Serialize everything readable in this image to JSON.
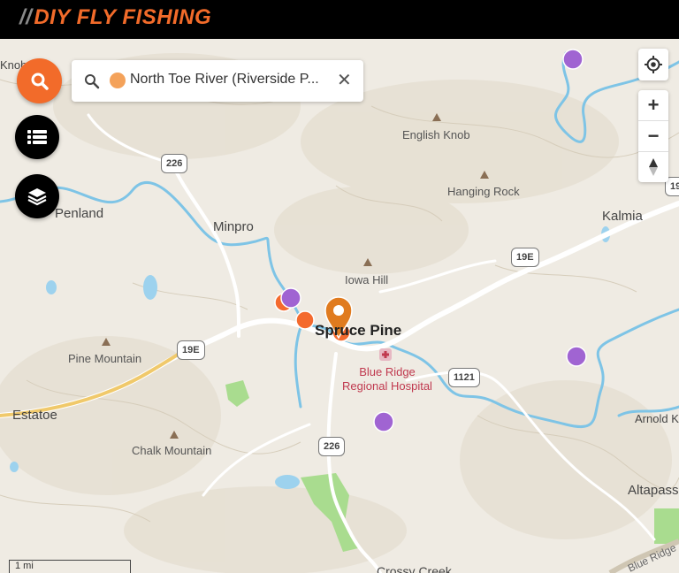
{
  "header": {
    "brand_slashes": "//",
    "brand_name": "DIY FLY FISHING",
    "brand_color": "#f26b2a",
    "background": "#000000"
  },
  "search": {
    "query": "North Toe River (Riverside P...",
    "dot_color": "#f4a25a",
    "search_icon": "search-icon",
    "clear_icon": "close-icon"
  },
  "left_buttons": [
    {
      "name": "search-button",
      "icon": "search-icon",
      "color": "#f26b2a"
    },
    {
      "name": "list-button",
      "icon": "list-icon",
      "color": "#000000"
    },
    {
      "name": "layers-button",
      "icon": "layers-icon",
      "color": "#000000"
    }
  ],
  "map_controls": [
    {
      "name": "locate-button",
      "icon": "crosshair-icon"
    },
    {
      "name": "zoom-in-button",
      "label": "+"
    },
    {
      "name": "zoom-out-button",
      "label": "−"
    },
    {
      "name": "compass-button",
      "icon": "compass-icon"
    }
  ],
  "labels": {
    "towns": [
      "Penland",
      "Minpro",
      "Kalmia",
      "Estatoe",
      "Altapass",
      "Knob",
      "Arnold K",
      "Crossy Creek"
    ],
    "city": "Spruce Pine",
    "peaks": [
      "English Knob",
      "Hanging Rock",
      "Iowa Hill",
      "Pine Mountain",
      "Chalk Mountain"
    ],
    "hospital": [
      "Blue Ridge",
      "Regional Hospital"
    ],
    "road_label": "Blue Ridge"
  },
  "shields": [
    "226",
    "19E",
    "19E",
    "1121",
    "226",
    "19"
  ],
  "markers": {
    "purple_color": "#a064d2",
    "orange_color": "#f46a2e",
    "pin_color": "#e07b1f"
  },
  "scale_bar": "1 mi"
}
